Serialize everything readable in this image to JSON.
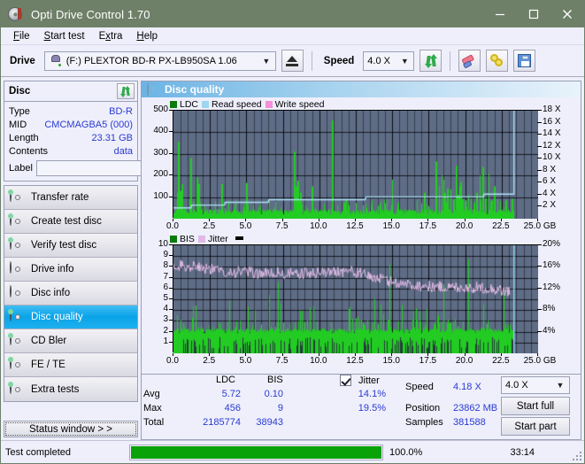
{
  "window": {
    "title": "Opti Drive Control 1.70",
    "icon": "disc-icon",
    "minimize": "minimize",
    "maximize": "maximize",
    "close": "close"
  },
  "menu": {
    "items": [
      {
        "label": "File",
        "accel": "F"
      },
      {
        "label": "Start test",
        "accel": "S"
      },
      {
        "label": "Extra",
        "accel": "x"
      },
      {
        "label": "Help",
        "accel": "H"
      }
    ]
  },
  "toolbar": {
    "drive_label": "Drive",
    "drive_value": "(F:)   PLEXTOR BD-R  PX-LB950SA 1.06",
    "drive_icon": "drive-icon",
    "eject_icon": "eject-icon",
    "speed_label": "Speed",
    "speed_value": "4.0 X",
    "refresh_icon": "refresh-icon",
    "erase_icon": "eraser-icon",
    "tools_icon": "tools-icon",
    "save_icon": "save-icon"
  },
  "disc": {
    "title": "Disc",
    "refresh_icon": "refresh-icon",
    "rows": [
      {
        "key": "Type",
        "value": "BD-R"
      },
      {
        "key": "MID",
        "value": "CMCMAGBA5 (000)"
      },
      {
        "key": "Length",
        "value": "23.31 GB"
      },
      {
        "key": "Contents",
        "value": "data"
      }
    ],
    "label_key": "Label",
    "label_value": "",
    "label_placeholder": "",
    "label_icon": "cd-icon"
  },
  "sidebar": {
    "items": [
      {
        "label": "Transfer rate",
        "icon": "disc-test-icon",
        "active": false
      },
      {
        "label": "Create test disc",
        "icon": "disc-create-icon",
        "active": false
      },
      {
        "label": "Verify test disc",
        "icon": "disc-verify-icon",
        "active": false
      },
      {
        "label": "Drive info",
        "icon": "drive-info-icon",
        "active": false
      },
      {
        "label": "Disc info",
        "icon": "disc-info-icon",
        "active": false
      },
      {
        "label": "Disc quality",
        "icon": "disc-quality-icon",
        "active": true
      },
      {
        "label": "CD Bler",
        "icon": "cd-bler-icon",
        "active": false
      },
      {
        "label": "FE / TE",
        "icon": "fe-te-icon",
        "active": false
      },
      {
        "label": "Extra tests",
        "icon": "extra-tests-icon",
        "active": false
      }
    ],
    "status_window_button": "Status window > >"
  },
  "main": {
    "header_title": "Disc quality",
    "header_icon": "disc-quality-icon"
  },
  "chart_data": [
    {
      "id": "ldc-chart",
      "type": "line",
      "title": "",
      "xlabel": "GB",
      "ylabel": "LDC",
      "legend": [
        {
          "name": "LDC",
          "color": "#0a7a0a"
        },
        {
          "name": "Read speed",
          "color": "#9cd6f0"
        },
        {
          "name": "Write speed",
          "color": "#f58fd8"
        }
      ],
      "legend_position": "top-left",
      "grid": true,
      "xlim": [
        0,
        25.0
      ],
      "xticks": [
        "0.0",
        "2.5",
        "5.0",
        "7.5",
        "10.0",
        "12.5",
        "15.0",
        "17.5",
        "20.0",
        "22.5",
        "25.0 GB"
      ],
      "ylim": [
        0,
        500
      ],
      "yticks": [
        "100",
        "200",
        "300",
        "400",
        "500"
      ],
      "y2lim": [
        0,
        18
      ],
      "y2ticks": [
        "2 X",
        "4 X",
        "6 X",
        "8 X",
        "10 X",
        "12 X",
        "14 X",
        "16 X",
        "18 X"
      ],
      "series": [
        {
          "name": "LDC",
          "color": "#22cc22",
          "x": [
            0.05,
            0.15,
            0.25,
            0.35,
            0.4,
            0.45,
            0.5,
            0.6,
            0.7,
            0.8,
            0.9,
            1.0,
            1.1,
            1.2,
            1.3,
            1.4,
            1.5,
            1.6,
            1.7,
            1.8,
            1.9,
            2.0,
            2.1,
            2.2,
            2.3,
            2.5,
            2.7,
            2.9,
            3.1,
            3.3,
            3.5,
            3.7,
            3.9,
            4.1,
            4.3,
            4.5,
            4.7,
            4.9,
            5.0,
            5.1,
            5.3,
            5.5,
            5.7,
            5.9,
            6.1,
            6.3,
            6.5,
            6.7,
            6.9,
            7.1,
            7.3,
            7.5,
            7.7,
            7.9,
            8.1,
            8.3,
            8.4,
            8.5,
            8.6,
            8.7,
            8.9,
            9.1,
            9.3,
            9.5,
            9.7,
            9.9,
            10.1,
            10.3,
            10.5,
            10.7,
            10.9,
            11.1,
            11.25,
            11.4,
            11.6,
            11.8,
            12.0,
            12.2,
            12.4,
            12.6,
            12.8,
            13.0,
            13.2,
            13.4,
            13.6,
            13.8,
            14.0,
            14.2,
            14.4,
            14.6,
            14.8,
            15.0,
            15.2,
            15.4,
            15.6,
            15.8,
            16.0,
            16.2,
            16.4,
            16.6,
            16.8,
            17.0,
            17.2,
            17.4,
            17.6,
            17.8,
            18.0,
            18.2,
            18.4,
            18.5,
            18.6,
            18.8,
            19.0,
            19.2,
            19.4,
            19.5,
            19.6,
            19.7,
            19.8,
            20.0,
            20.2,
            20.4,
            20.6,
            20.8,
            21.0,
            21.2,
            21.4,
            21.6,
            21.8,
            22.0,
            22.2,
            22.4,
            22.6,
            22.8,
            23.0,
            23.2,
            23.3
          ],
          "y": [
            35,
            60,
            120,
            355,
            90,
            130,
            70,
            160,
            45,
            60,
            55,
            70,
            90,
            280,
            55,
            50,
            60,
            190,
            160,
            55,
            70,
            45,
            40,
            50,
            60,
            40,
            45,
            50,
            55,
            160,
            45,
            50,
            45,
            55,
            60,
            50,
            45,
            50,
            165,
            50,
            45,
            55,
            50,
            60,
            45,
            50,
            55,
            45,
            50,
            60,
            45,
            50,
            55,
            45,
            50,
            310,
            150,
            175,
            60,
            120,
            55,
            50,
            60,
            150,
            55,
            50,
            45,
            55,
            60,
            50,
            455,
            60,
            55,
            70,
            60,
            90,
            55,
            60,
            50,
            55,
            45,
            50,
            60,
            55,
            50,
            60,
            45,
            50,
            55,
            60,
            50,
            180,
            55,
            60,
            50,
            45,
            55,
            60,
            50,
            70,
            55,
            60,
            120,
            50,
            55,
            60,
            265,
            150,
            200,
            180,
            120,
            140,
            135,
            90,
            245,
            110,
            150,
            170,
            90,
            85,
            110,
            90,
            75,
            120,
            200,
            240,
            95,
            210,
            85,
            150,
            90,
            80,
            70,
            85,
            60
          ]
        },
        {
          "name": "Read speed",
          "color": "#aee2f6",
          "x": [
            0.0,
            1.0,
            2.0,
            3.0,
            4.0,
            5.0,
            6.0,
            7.0,
            8.0,
            9.0,
            10.0,
            11.0,
            12.0,
            13.0,
            14.0,
            15.0,
            16.0,
            17.0,
            18.0,
            19.0,
            20.0,
            21.0,
            22.0,
            23.2,
            23.3
          ],
          "y": [
            1.8,
            2.0,
            2.2,
            2.4,
            2.6,
            2.8,
            2.9,
            3.0,
            3.1,
            3.15,
            3.2,
            3.3,
            3.35,
            3.4,
            3.45,
            3.5,
            3.5,
            3.6,
            3.65,
            3.7,
            3.75,
            3.85,
            3.9,
            4.0,
            18.0
          ]
        }
      ]
    },
    {
      "id": "bis-jitter-chart",
      "type": "line",
      "title": "",
      "xlabel": "GB",
      "ylabel": "BIS",
      "legend": [
        {
          "name": "BIS",
          "color": "#0a7a0a"
        },
        {
          "name": "Jitter",
          "color": "#e0b8e8"
        }
      ],
      "legend_position": "top-left",
      "grid": true,
      "xlim": [
        0,
        25.0
      ],
      "xticks": [
        "0.0",
        "2.5",
        "5.0",
        "7.5",
        "10.0",
        "12.5",
        "15.0",
        "17.5",
        "20.0",
        "22.5",
        "25.0 GB"
      ],
      "ylim": [
        0,
        10
      ],
      "yticks": [
        "1",
        "2",
        "3",
        "4",
        "5",
        "6",
        "7",
        "8",
        "9",
        "10"
      ],
      "y2lim": [
        0,
        20
      ],
      "y2ticks": [
        "4%",
        "8%",
        "12%",
        "16%",
        "20%"
      ],
      "series": [
        {
          "name": "BIS",
          "color": "#22cc22",
          "baseline": 1.8
        },
        {
          "name": "Jitter",
          "color": "#e6bee8",
          "x": [
            0.0,
            0.5,
            1.0,
            1.5,
            2.0,
            2.5,
            3.0,
            3.5,
            4.0,
            4.5,
            5.0,
            5.5,
            6.0,
            6.5,
            7.0,
            7.5,
            8.0,
            8.5,
            9.0,
            9.5,
            10.0,
            10.5,
            11.0,
            11.5,
            12.0,
            12.5,
            13.0,
            13.5,
            14.0,
            14.5,
            15.0,
            15.5,
            16.0,
            16.5,
            17.0,
            17.5,
            18.0,
            18.5,
            19.0,
            19.5,
            20.0,
            20.5,
            21.0,
            21.5,
            22.0,
            22.5,
            23.0,
            23.3
          ],
          "y": [
            16.5,
            16.2,
            16.0,
            16.4,
            15.9,
            15.6,
            15.3,
            15.2,
            15.0,
            15.1,
            15.2,
            14.8,
            14.9,
            14.7,
            15.0,
            14.6,
            14.8,
            14.5,
            14.9,
            14.6,
            15.2,
            14.8,
            15.4,
            15.1,
            15.3,
            15.0,
            14.6,
            14.2,
            13.9,
            13.5,
            13.2,
            13.0,
            12.8,
            12.6,
            12.5,
            12.4,
            12.3,
            12.3,
            12.2,
            12.3,
            12.2,
            12.1,
            12.2,
            12.0,
            11.9,
            11.6,
            11.4,
            13.0
          ]
        }
      ]
    }
  ],
  "stats": {
    "col_ldc": "LDC",
    "col_bis": "BIS",
    "jitter_label": "Jitter",
    "jitter_checked": true,
    "rows": [
      {
        "name": "Avg",
        "ldc": "5.72",
        "bis": "0.10",
        "jitter": "14.1%"
      },
      {
        "name": "Max",
        "ldc": "456",
        "bis": "9",
        "jitter": "19.5%"
      },
      {
        "name": "Total",
        "ldc": "2185774",
        "bis": "38943",
        "jitter": ""
      }
    ],
    "speed_label": "Speed",
    "speed_value": "4.18 X",
    "position_label": "Position",
    "position_value": "23862 MB",
    "samples_label": "Samples",
    "samples_value": "381588",
    "speed_select": "4.0 X",
    "start_full": "Start full",
    "start_part": "Start part"
  },
  "statusbar": {
    "message": "Test completed",
    "progress_pct": 100.0,
    "progress_text": "100.0%",
    "elapsed": "33:14"
  },
  "colors": {
    "titlebar": "#6e8068",
    "accent": "#2b3ad1",
    "plot_bg": "#5e6c86",
    "ldc_green": "#22cc22",
    "read_speed": "#aee2f6",
    "write_speed": "#f58fd8",
    "jitter": "#e6bee8",
    "progress_green": "#09a208",
    "nav_active": "#0aa3e8"
  }
}
